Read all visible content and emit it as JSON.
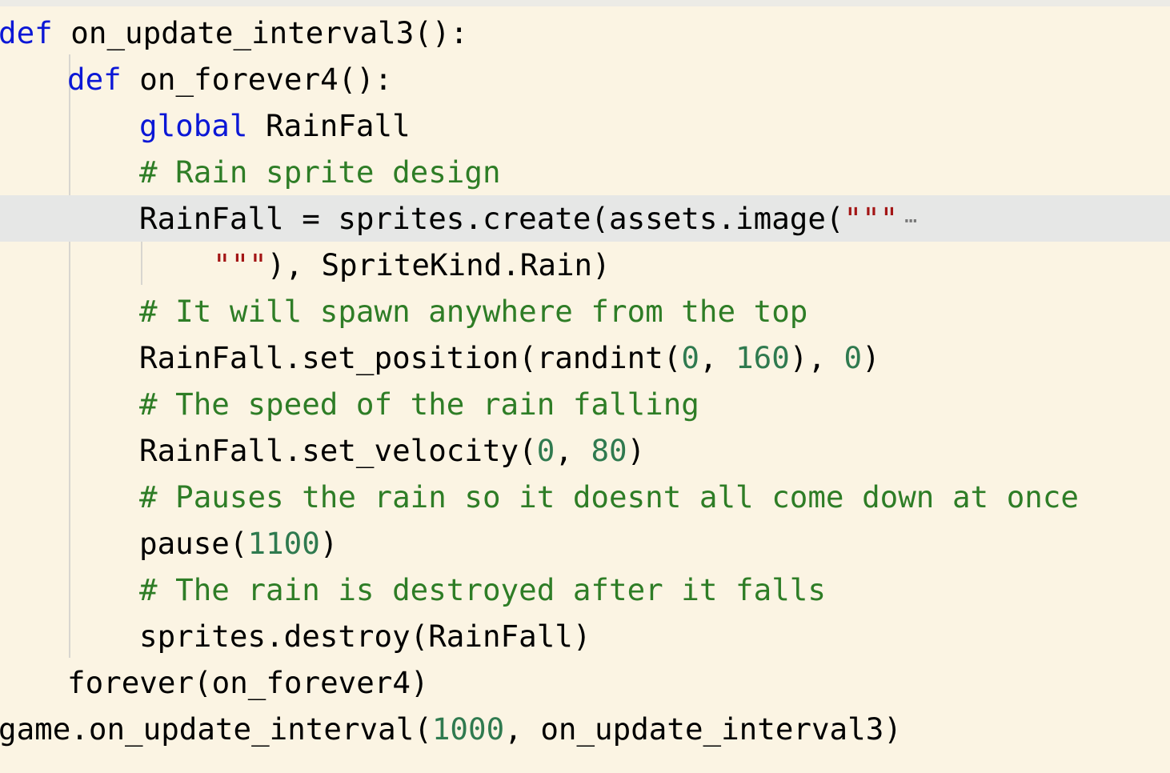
{
  "colors": {
    "background": "#fbf4e3",
    "highlight_line": "#e6e7e6",
    "keyword": "#0b17d6",
    "comment": "#2e7d26",
    "number": "#2f7a4f",
    "string": "#a31515",
    "default": "#000000"
  },
  "highlighted_line": 4,
  "lines": [
    {
      "indent": 0,
      "tokens": [
        {
          "t": "def",
          "c": "kw"
        },
        {
          "t": " on_update_interval3():",
          "c": ""
        }
      ]
    },
    {
      "indent": 1,
      "tokens": [
        {
          "t": "def",
          "c": "kw"
        },
        {
          "t": " on_forever4():",
          "c": ""
        }
      ]
    },
    {
      "indent": 2,
      "tokens": [
        {
          "t": "global",
          "c": "kw"
        },
        {
          "t": " RainFall",
          "c": ""
        }
      ]
    },
    {
      "indent": 2,
      "tokens": [
        {
          "t": "# Rain sprite design",
          "c": "cm"
        }
      ]
    },
    {
      "indent": 2,
      "tokens": [
        {
          "t": "RainFall = sprites.create(assets.image(",
          "c": ""
        },
        {
          "t": "\"\"\"",
          "c": "str"
        },
        {
          "t": "⋯",
          "c": "fold"
        }
      ]
    },
    {
      "indent": 3,
      "tokens": [
        {
          "t": "\"\"\"",
          "c": "str"
        },
        {
          "t": "), SpriteKind.Rain)",
          "c": ""
        }
      ]
    },
    {
      "indent": 2,
      "tokens": [
        {
          "t": "# It will spawn anywhere from the top",
          "c": "cm"
        }
      ]
    },
    {
      "indent": 2,
      "tokens": [
        {
          "t": "RainFall.set_position(randint(",
          "c": ""
        },
        {
          "t": "0",
          "c": "num"
        },
        {
          "t": ", ",
          "c": ""
        },
        {
          "t": "160",
          "c": "num"
        },
        {
          "t": "), ",
          "c": ""
        },
        {
          "t": "0",
          "c": "num"
        },
        {
          "t": ")",
          "c": ""
        }
      ]
    },
    {
      "indent": 2,
      "tokens": [
        {
          "t": "# The speed of the rain falling",
          "c": "cm"
        }
      ]
    },
    {
      "indent": 2,
      "tokens": [
        {
          "t": "RainFall.set_velocity(",
          "c": ""
        },
        {
          "t": "0",
          "c": "num"
        },
        {
          "t": ", ",
          "c": ""
        },
        {
          "t": "80",
          "c": "num"
        },
        {
          "t": ")",
          "c": ""
        }
      ]
    },
    {
      "indent": 2,
      "tokens": [
        {
          "t": "# Pauses the rain so it doesnt all come down at once",
          "c": "cm"
        }
      ]
    },
    {
      "indent": 2,
      "tokens": [
        {
          "t": "pause(",
          "c": ""
        },
        {
          "t": "1100",
          "c": "num"
        },
        {
          "t": ")",
          "c": ""
        }
      ]
    },
    {
      "indent": 2,
      "tokens": [
        {
          "t": "# The rain is destroyed after it falls",
          "c": "cm"
        }
      ]
    },
    {
      "indent": 2,
      "tokens": [
        {
          "t": "sprites.destroy(RainFall)",
          "c": ""
        }
      ]
    },
    {
      "indent": 1,
      "tokens": [
        {
          "t": "forever(on_forever4)",
          "c": ""
        }
      ]
    },
    {
      "indent": 0,
      "tokens": [
        {
          "t": "game.on_update_interval(",
          "c": ""
        },
        {
          "t": "1000",
          "c": "num"
        },
        {
          "t": ", on_update_interval3)",
          "c": ""
        }
      ]
    }
  ]
}
